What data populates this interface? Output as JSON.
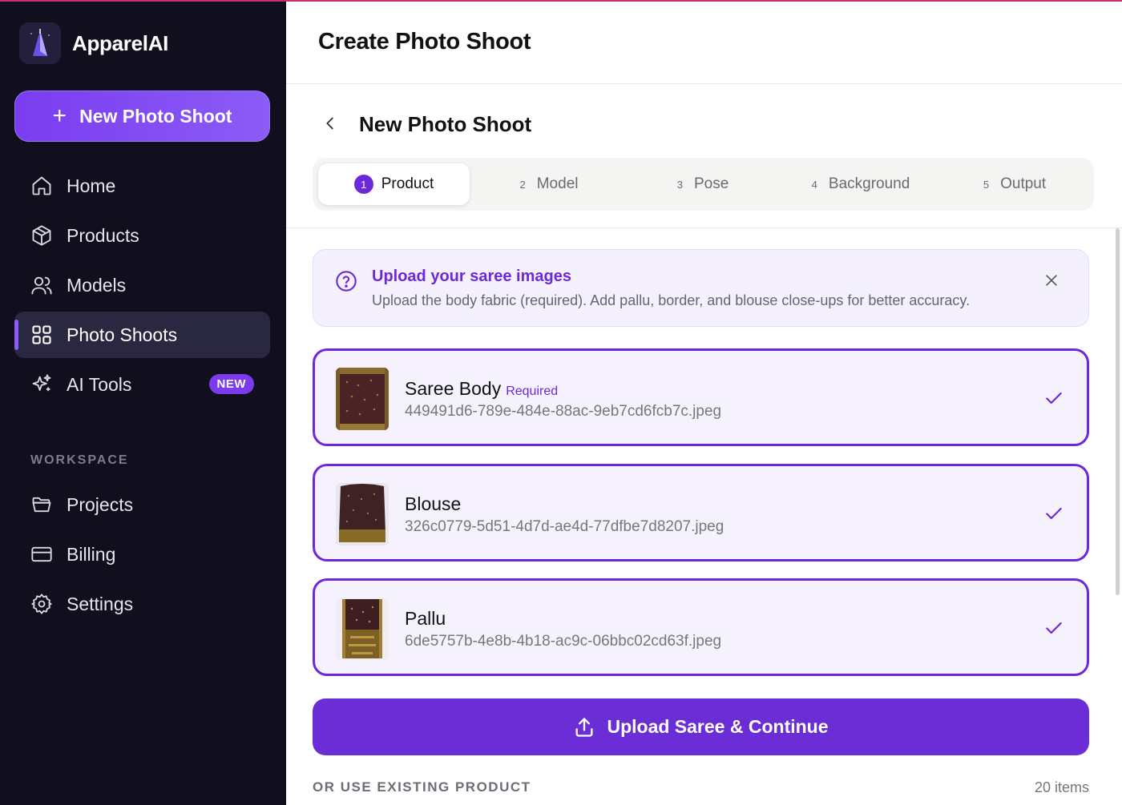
{
  "app": {
    "name": "ApparelAI"
  },
  "sidebar": {
    "new_shoot_label": "New Photo Shoot",
    "items": [
      {
        "label": "Home",
        "icon": "home-icon"
      },
      {
        "label": "Products",
        "icon": "box-icon"
      },
      {
        "label": "Models",
        "icon": "users-icon"
      },
      {
        "label": "Photo Shoots",
        "icon": "grid-icon",
        "active": true
      },
      {
        "label": "AI Tools",
        "icon": "sparkles-icon",
        "badge": "NEW"
      }
    ],
    "workspace_label": "WORKSPACE",
    "workspace_items": [
      {
        "label": "Projects",
        "icon": "folder-icon"
      },
      {
        "label": "Billing",
        "icon": "credit-card-icon"
      },
      {
        "label": "Settings",
        "icon": "gear-icon"
      }
    ]
  },
  "header": {
    "title": "Create Photo Shoot"
  },
  "wizard": {
    "title": "New Photo Shoot",
    "steps": [
      {
        "num": "1",
        "label": "Product",
        "active": true
      },
      {
        "num": "2",
        "label": "Model"
      },
      {
        "num": "3",
        "label": "Pose"
      },
      {
        "num": "4",
        "label": "Background"
      },
      {
        "num": "5",
        "label": "Output"
      }
    ]
  },
  "info": {
    "title": "Upload your saree images",
    "text": "Upload the body fabric (required). Add pallu, border, and blouse close-ups for better accuracy."
  },
  "uploads": [
    {
      "title": "Saree Body",
      "required_label": "Required",
      "file": "449491d6-789e-484e-88ac-9eb7cd6fcb7c.jpeg"
    },
    {
      "title": "Blouse",
      "file": "326c0779-5d51-4d7d-ae4d-77dfbe7d8207.jpeg"
    },
    {
      "title": "Pallu",
      "file": "6de5757b-4e8b-4b18-ac9c-06bbc02cd63f.jpeg"
    }
  ],
  "actions": {
    "upload_label": "Upload Saree & Continue",
    "existing_label": "OR USE EXISTING PRODUCT",
    "items_count": "20 items"
  },
  "colors": {
    "accent": "#6d28d9",
    "sidebar_bg": "#110f1e",
    "card_bg": "#f5f2fe"
  }
}
